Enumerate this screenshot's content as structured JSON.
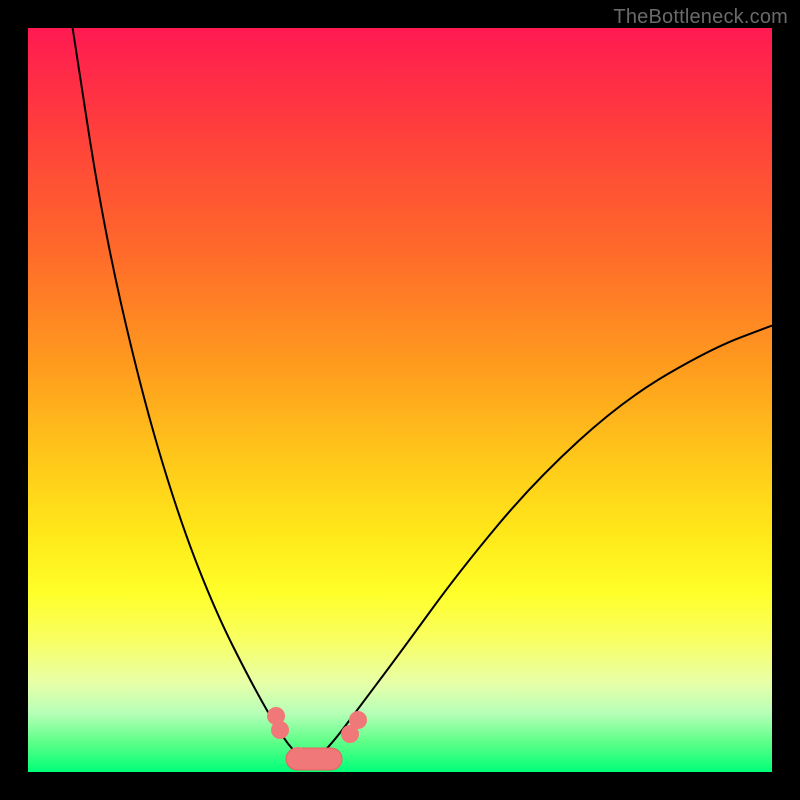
{
  "watermark": "TheBottleneck.com",
  "chart_data": {
    "type": "line",
    "title": "",
    "xlabel": "",
    "ylabel": "",
    "xlim": [
      0,
      100
    ],
    "ylim": [
      0,
      100
    ],
    "grid": false,
    "legend": false,
    "series": [
      {
        "name": "bottleneck-curve",
        "x": [
          6,
          10,
          15,
          20,
          25,
          30,
          34,
          36,
          37.5,
          39,
          41,
          44,
          50,
          58,
          68,
          80,
          92,
          100
        ],
        "y": [
          100,
          74,
          52,
          35,
          22,
          12,
          5,
          2.5,
          1.5,
          2,
          4,
          8,
          16,
          27,
          39,
          50,
          57,
          60
        ]
      }
    ],
    "annotations": [
      {
        "name": "valley-markers",
        "x_range": [
          33,
          43
        ],
        "style": "pink-dots"
      }
    ],
    "background_gradient": {
      "top": "#ff1a52",
      "mid": "#ffe81a",
      "bottom": "#00ff78"
    }
  }
}
